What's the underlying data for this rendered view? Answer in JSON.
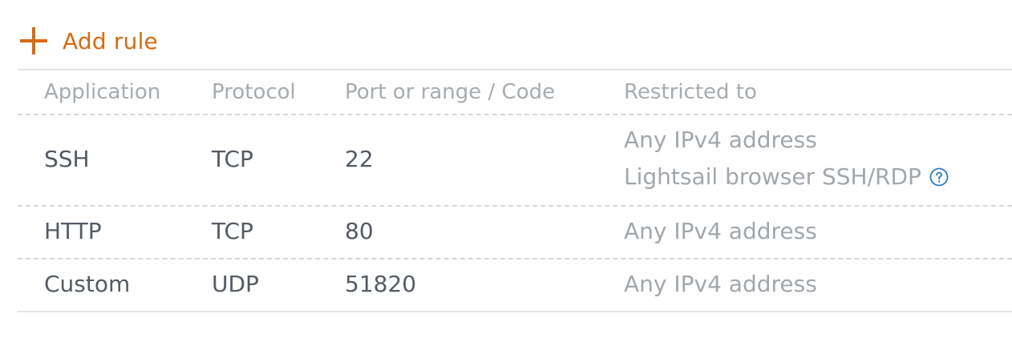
{
  "add_rule": {
    "label": "Add rule",
    "icon": "plus-icon",
    "color": "#d56b12"
  },
  "table": {
    "headers": [
      "Application",
      "Protocol",
      "Port or range / Code",
      "Restricted to"
    ],
    "rows": [
      {
        "application": "SSH",
        "protocol": "TCP",
        "port": "22",
        "restricted": [
          "Any IPv4 address",
          "Lightsail browser SSH/RDP"
        ],
        "help_icon": "question-circle-icon"
      },
      {
        "application": "HTTP",
        "protocol": "TCP",
        "port": "80",
        "restricted": [
          "Any IPv4 address"
        ]
      },
      {
        "application": "Custom",
        "protocol": "UDP",
        "port": "51820",
        "restricted": [
          "Any IPv4 address"
        ]
      }
    ]
  },
  "colors": {
    "header_text": "#a7acb1",
    "value_text": "#545b64",
    "muted_text": "#a2a7ac",
    "help_icon": "#2e7bc4"
  }
}
